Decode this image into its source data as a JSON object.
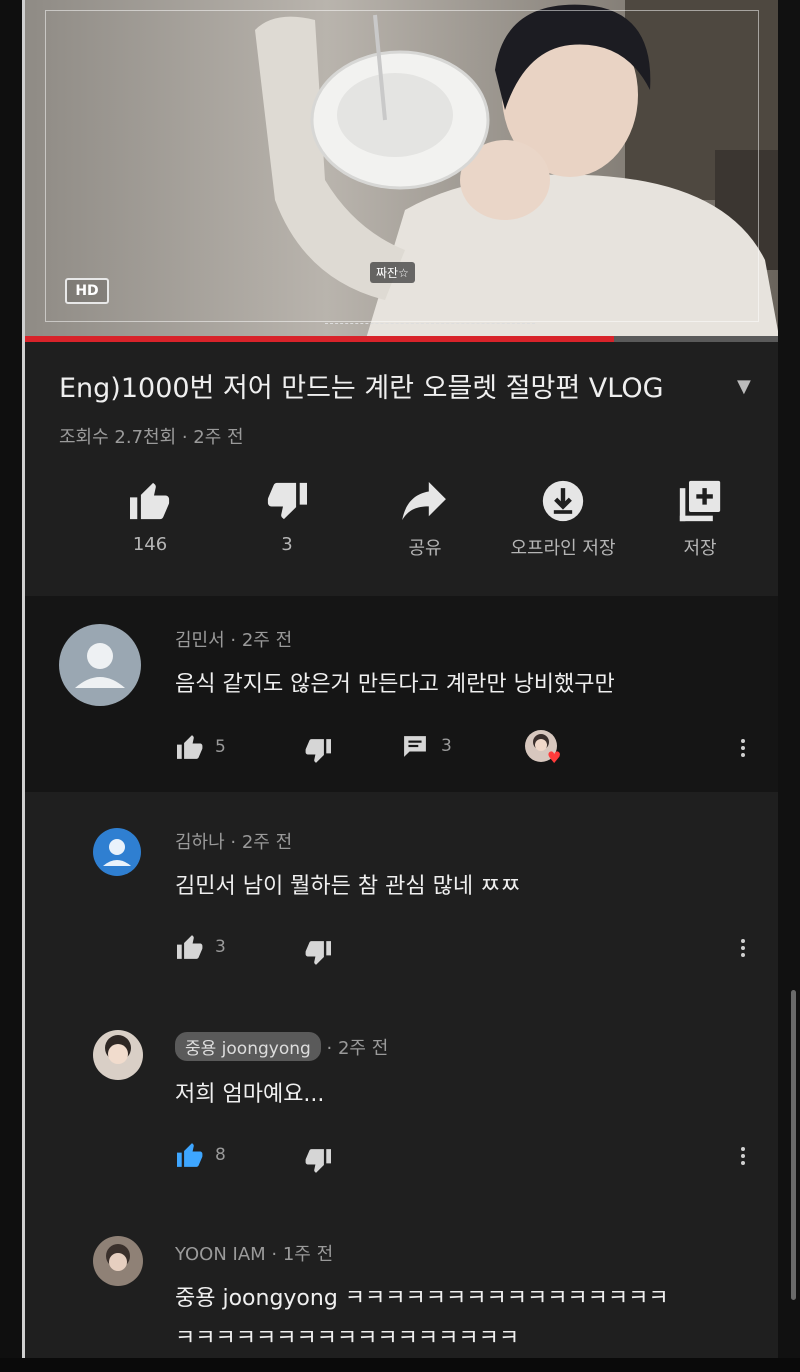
{
  "video": {
    "hd_badge": "HD",
    "overlay_tag": "짜잔☆",
    "progress": 0.78
  },
  "title": "Eng)1000번 저어 만드는 계란 오믈렛 절망편 VLOG",
  "meta": "조회수 2.7천회 · 2주 전",
  "actions": {
    "like": "146",
    "dislike": "3",
    "share": "공유",
    "offline": "오프라인 저장",
    "save": "저장"
  },
  "comments": [
    {
      "author": "김민서 · 2주 전",
      "text": "음식 같지도 않은거 만든다고 계란만 낭비했구만",
      "likes": "5",
      "replies": "3"
    },
    {
      "author": "김하나 · 2주 전",
      "text": "김민서 남이 뭘하든 참 관심 많네 ㅉㅉ",
      "likes": "3"
    },
    {
      "author_chip": "중용 joongyong",
      "time": " · 2주 전",
      "text": "저희 엄마예요...",
      "likes": "8"
    },
    {
      "author": "YOON IAM · 1주 전",
      "text_line1": "중용 joongyong ㅋㅋㅋㅋㅋㅋㅋㅋㅋㅋㅋㅋㅋㅋㅋㅋ",
      "text_line2": "ㅋㅋㅋㅋㅋㅋㅋㅋㅋㅋㅋㅋㅋㅋㅋㅋㅋ"
    }
  ],
  "colors": {
    "accent_red": "#d8232a",
    "liked_blue": "#3ea6ff"
  }
}
